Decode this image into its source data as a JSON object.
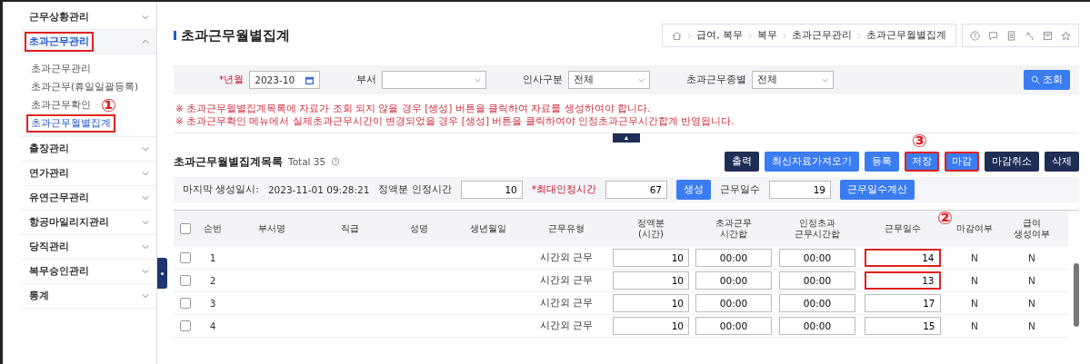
{
  "sidebar": {
    "items": [
      {
        "label": "근무상황관리",
        "expanded": false,
        "highlighted": false
      },
      {
        "label": "초과근무관리",
        "expanded": true,
        "highlighted": true,
        "children": [
          {
            "label": "초과근무관리",
            "selected": false,
            "highlighted": false
          },
          {
            "label": "초과근무(휴일일괄등록)",
            "selected": false,
            "highlighted": false
          },
          {
            "label": "초과근무확인",
            "selected": false,
            "highlighted": false,
            "marker": "①"
          },
          {
            "label": "초과근무월별집계",
            "selected": true,
            "highlighted": true
          }
        ]
      },
      {
        "label": "출장관리",
        "expanded": false,
        "highlighted": false
      },
      {
        "label": "연가관리",
        "expanded": false,
        "highlighted": false
      },
      {
        "label": "유연근무관리",
        "expanded": false,
        "highlighted": false
      },
      {
        "label": "항공마일리지관리",
        "expanded": false,
        "highlighted": false
      },
      {
        "label": "당직관리",
        "expanded": false,
        "highlighted": false
      },
      {
        "label": "복무승인관리",
        "expanded": false,
        "highlighted": false
      },
      {
        "label": "통계",
        "expanded": false,
        "highlighted": false
      }
    ]
  },
  "page_title": "초과근무월별집계",
  "breadcrumb": [
    "급여, 복무",
    "복무",
    "초과근무관리",
    "초과근무월별집계"
  ],
  "search": {
    "year_month": {
      "label": "*년월",
      "value": "2023-10"
    },
    "fields": [
      {
        "label": "부서"
      },
      {
        "label": "인사구분",
        "value": "전체"
      },
      {
        "label": "초과근무종별",
        "value": "전체"
      }
    ],
    "button": "조회"
  },
  "notes": [
    "※ 초과근무월별집계목록에 자료가 조회 되지 않을 경우 [생성] 버튼을 클릭하여 자료를 생성하여야 합니다.",
    "※ 초과근무확인 메뉴에서 실제초과근무시간이 변경되었을 경우 [생성] 버튼을 클릭하여야 인정초과근무시간합계 반영됩니다."
  ],
  "collapse_button": "▲",
  "list": {
    "title": "초과근무월별집계목록",
    "total": "Total 35",
    "buttons": [
      {
        "label": "출력",
        "kind": "dark",
        "highlighted": false
      },
      {
        "label": "최신자료가져오기",
        "kind": "blue",
        "highlighted": false
      },
      {
        "label": "등록",
        "kind": "blue",
        "highlighted": false
      },
      {
        "label": "저장",
        "kind": "blue",
        "highlighted": true,
        "marker": "③"
      },
      {
        "label": "마감",
        "kind": "blue",
        "highlighted": true
      },
      {
        "label": "마감취소",
        "kind": "dark",
        "highlighted": false
      },
      {
        "label": "삭제",
        "kind": "dark",
        "highlighted": false
      }
    ],
    "info": {
      "generated_label": "마지막 생성일시:",
      "generated_value": "2023-11-01 09:28:21",
      "fixed_label": "정액분 인정시간",
      "fixed_value": "10",
      "max_label": "*최대인정시간",
      "max_value": "67",
      "generate_button": "생성",
      "days_label": "근무일수",
      "days_value": "19",
      "days_button": "근무일수계산"
    }
  },
  "table": {
    "header_checked": false,
    "columns": [
      "순번",
      "부서명",
      "직급",
      "성명",
      "생년월일",
      "근무유형",
      "정액분\n(시간)",
      "초과근무\n시간합",
      "인정초과\n근무시간합",
      "근무일수",
      "마감여부",
      "급여\n생성여부"
    ],
    "marker": "②",
    "rows": [
      {
        "checked": false,
        "no": "1",
        "type": "시간외 근무",
        "fixed": "10",
        "overtime": "00:00",
        "approved": "00:00",
        "days": "14",
        "days_highlighted": true,
        "closed": "N",
        "pay": "N"
      },
      {
        "checked": false,
        "no": "2",
        "type": "시간외 근무",
        "fixed": "10",
        "overtime": "00:00",
        "approved": "00:00",
        "days": "13",
        "days_highlighted": true,
        "closed": "N",
        "pay": "N"
      },
      {
        "checked": false,
        "no": "3",
        "type": "시간외 근무",
        "fixed": "10",
        "overtime": "00:00",
        "approved": "00:00",
        "days": "17",
        "days_highlighted": false,
        "closed": "N",
        "pay": "N"
      },
      {
        "checked": false,
        "no": "4",
        "type": "시간외 근무",
        "fixed": "10",
        "overtime": "00:00",
        "approved": "00:00",
        "days": "15",
        "days_highlighted": false,
        "closed": "N",
        "pay": "N"
      }
    ]
  }
}
